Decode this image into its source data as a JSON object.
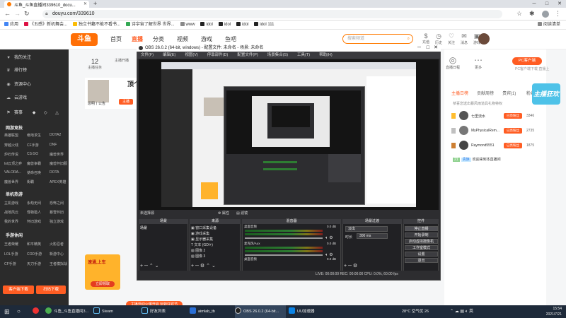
{
  "browser": {
    "tabs": [
      {
        "title": "斗鱼_斗鱼直播间339610_docu..."
      }
    ],
    "url": "douyu.com/339610",
    "bookmarks": [
      "应用",
      "《五感》新机舞会...",
      "独立书籍不能不看书...",
      "诗宇宙了解世界 世界...",
      "www",
      "idol",
      "idol",
      "idol",
      "idol 111"
    ],
    "reading_list": "阅读清单"
  },
  "douyu": {
    "logo": "斗鱼",
    "nav": [
      "首页",
      "直播",
      "分类",
      "视频",
      "游戏",
      "鱼吧"
    ],
    "search_placeholder": "搜索频道",
    "header_icons": [
      {
        "icon": "dollar-icon",
        "label": "充值"
      },
      {
        "icon": "history-icon",
        "label": "历史"
      },
      {
        "icon": "follow-icon",
        "label": "关注"
      },
      {
        "icon": "message-icon",
        "label": "消息"
      },
      {
        "icon": "game-icon",
        "label": "游戏"
      }
    ],
    "sidebar": {
      "items": [
        {
          "icon": "heart-icon",
          "label": "我的关注"
        },
        {
          "icon": "rank-icon",
          "label": "排行榜"
        },
        {
          "icon": "center-icon",
          "label": "资源中心"
        },
        {
          "icon": "cloud-icon",
          "label": "云游戏"
        }
      ],
      "row_icons": [
        "赛事",
        "◆",
        "◇",
        "△"
      ],
      "sections": [
        {
          "title": "网游竞技",
          "cells": [
            "英雄联盟",
            "绝地求生",
            "DOTA2",
            "穿越火线",
            "CF手游",
            "DNF",
            "炉石传说",
            "CS:GO",
            "魔兽世界",
            "lol云顶之弈",
            "魔兽争霸",
            "魔兽怀旧服",
            "VALORA...",
            "使命召唤",
            "DOTA",
            "魔兽世界",
            "街霸",
            "APEX英雄"
          ]
        },
        {
          "title": "单机热游",
          "cells": [
            "主机游戏",
            "永劫无间",
            "恐怖之间",
            "战地风云",
            "怪物猎人",
            "暴雪怀旧",
            "我的世界",
            "怀旧游戏",
            "独立游戏"
          ]
        },
        {
          "title": "手游休闲",
          "cells": [
            "王者荣耀",
            "和平精英",
            "火影忍者",
            "LOL手游",
            "COD手游",
            "新游中心",
            "CF手游",
            "天刀手游",
            "王者模拟战"
          ]
        }
      ],
      "btn_left": "客户端下载",
      "btn_right": "扫码下载"
    },
    "stats": [
      {
        "value": "12",
        "label": "主播任务"
      },
      {
        "value": "",
        "label": "主播开播"
      }
    ],
    "anchor": {
      "name": "恩明丨公告",
      "badge": "主播",
      "title": "顶个小目"
    },
    "right_stats": [
      {
        "icon": "user-icon",
        "label": "直播日程"
      },
      {
        "icon": "more-icon",
        "label": "更多"
      }
    ],
    "pc_button": "PC客户端",
    "pc_sub": "PC客户端下载 直播上",
    "rank_tabs": [
      "主播日榜",
      "贡献周榜",
      "贵宾(1)",
      "粉丝团"
    ],
    "rank_banner": "主播狂欢",
    "rank_note": "恭喜您送出暴风雨道具礼物特权",
    "rank_rows": [
      {
        "name": "七里流水",
        "badge": "已亮粉丝",
        "score": "3346"
      },
      {
        "name": "MyPhysicalRem...",
        "badge": "已亮粉丝",
        "score": "2735"
      },
      {
        "name": "Raymond5551",
        "badge": "已亮粉丝",
        "score": "1875"
      }
    ],
    "welcome": {
      "level": "21",
      "noble": "贵族",
      "text": "欢迎来到本直播间"
    },
    "game_banner": {
      "title": "速通,上车",
      "button": "立即领取"
    },
    "bottom_btn": "主播活动火爆开启 玩转狂欢节"
  },
  "obs": {
    "title": "OBS 26.0.2 (64-bit, windows) - 配置文件: 未命名 - 场景: 未命名",
    "menu": [
      "文件(F)",
      "编辑(E)",
      "视图(V)",
      "停靠部件(D)",
      "配置文件(P)",
      "场景集合(S)",
      "工具(T)",
      "帮助(H)"
    ],
    "scene_label": "未选择源",
    "scene_props": "属性",
    "scene_filter": "滤镜",
    "docks": {
      "scenes": "场景",
      "sources": "来源",
      "mixer": "混音器",
      "transitions": "场景过渡",
      "controls": "控件"
    },
    "scene_list": [
      "场景"
    ],
    "sources_list": [
      "窗口采集设备",
      "游戏采集",
      "显示器采集",
      "文本 (GDI+)",
      "图像 2",
      "图像 3"
    ],
    "mixer_tracks": [
      {
        "label": "桌面音频",
        "db": "0.0 dB"
      },
      {
        "label": "麦克风/Aux",
        "db": "0.0 dB"
      },
      {
        "label": "桌面音频",
        "db": "0.0 dB"
      }
    ],
    "transition": {
      "type": "淡出",
      "duration_label": "时长",
      "duration": "300 ms"
    },
    "controls": [
      "停止直播",
      "开始录制",
      "启动虚拟摄像机",
      "工作室模式",
      "设置",
      "退出"
    ],
    "status": "LIVE: 00:00:00   REC: 00:00:00   CPU: 0.0%, 60.00 fps"
  },
  "taskbar": {
    "apps": [
      {
        "icon": "chrome-icon",
        "label": "斗鱼_斗鱼直播间3..."
      },
      {
        "icon": "steam-icon",
        "label": "Steam"
      },
      {
        "icon": "steam-icon",
        "label": "好友列表"
      },
      {
        "icon": "app-icon",
        "label": "aimlab_tb"
      },
      {
        "icon": "obs-icon",
        "label": "OBS 26.0.2 (64-bit..."
      },
      {
        "icon": "folder-icon",
        "label": "UU加速器"
      }
    ],
    "weather": "28°C  空气优 26",
    "time": "15:54",
    "date": "2021/7/21"
  }
}
